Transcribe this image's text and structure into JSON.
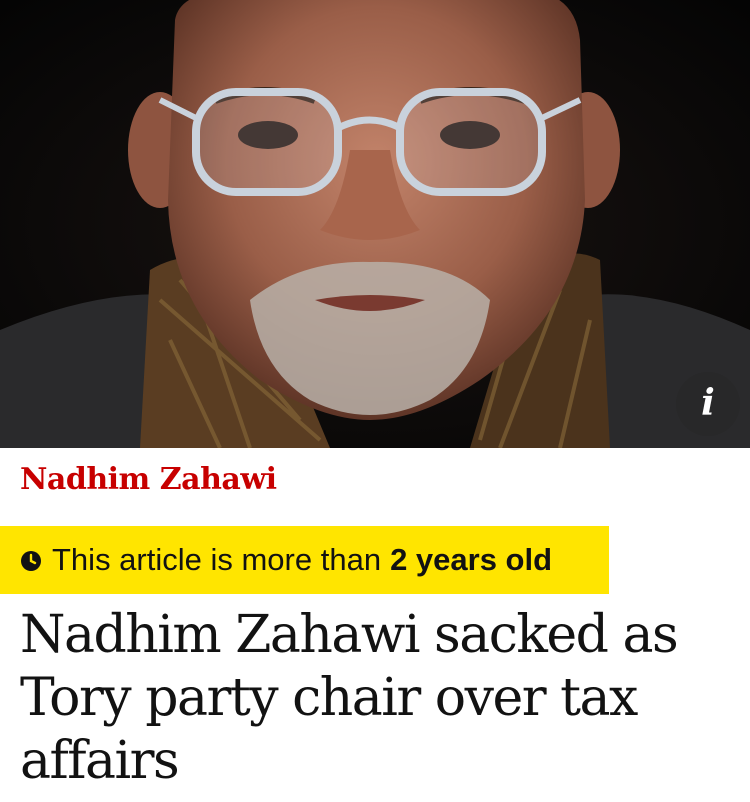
{
  "hero": {
    "image": "portrait-photo",
    "info_icon": "info-icon",
    "info_glyph": "i"
  },
  "kicker": {
    "label": "Nadhim Zahawi",
    "color": "#c70000"
  },
  "age_banner": {
    "icon": "clock-icon",
    "text": "This article is more than",
    "emphasis": "2 years old",
    "background": "#ffe500"
  },
  "headline": {
    "text": "Nadhim Zahawi sacked as Tory party chair over tax affairs"
  }
}
